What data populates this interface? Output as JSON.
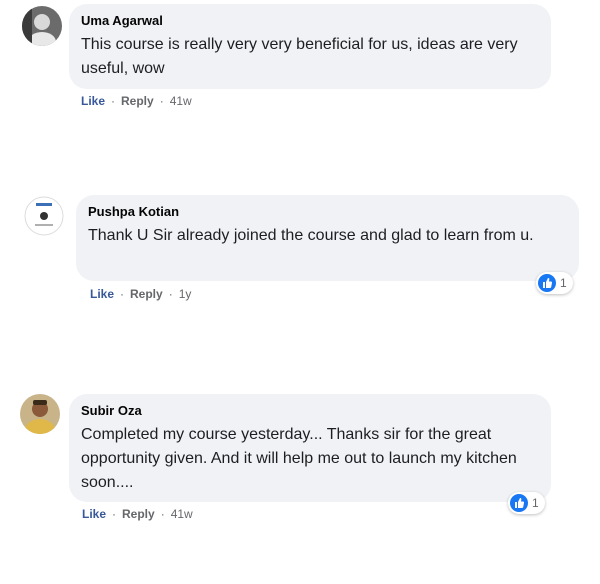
{
  "comments": [
    {
      "author": "Uma Agarwal",
      "text": "This course is really very very beneficial for us, ideas are very useful, wow",
      "like_label": "Like",
      "reply_label": "Reply",
      "separator": "·",
      "time": "41w",
      "reactions": null
    },
    {
      "author": "Pushpa Kotian",
      "text": "Thank U Sir already joined the course and glad to learn from u.",
      "like_label": "Like",
      "reply_label": "Reply",
      "separator": "·",
      "time": "1y",
      "reactions": {
        "type": "like",
        "count": "1"
      }
    },
    {
      "author": "Subir Oza",
      "text": "Completed my course yesterday... Thanks sir for the great opportunity given. And it will help me out to launch my kitchen soon....",
      "like_label": "Like",
      "reply_label": "Reply",
      "separator": "·",
      "time": "41w",
      "reactions": {
        "type": "like",
        "count": "1"
      }
    }
  ],
  "colors": {
    "bubble": "#f0f2f5",
    "like_link": "#385898",
    "reaction_blue": "#1877f2",
    "meta_gray": "#65676b"
  }
}
